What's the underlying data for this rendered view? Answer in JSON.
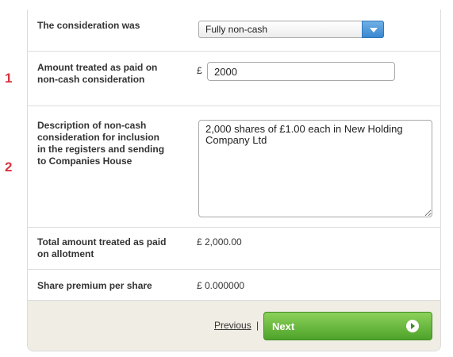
{
  "markers": [
    "1",
    "2"
  ],
  "rows": {
    "consideration": {
      "label": "The consideration was",
      "selected": "Fully non-cash"
    },
    "amount_paid": {
      "label": "Amount treated as paid on non-cash consideration",
      "currency": "£",
      "value": "2000"
    },
    "description": {
      "label": "Description of non-cash consideration for inclusion in the registers and sending to Companies House",
      "value": "2,000 shares of £1.00 each in New Holding Company Ltd"
    },
    "total": {
      "label": "Total amount treated as paid on allotment",
      "value": "£ 2,000.00"
    },
    "premium": {
      "label": "Share premium per share",
      "value": "£ 0.000000"
    }
  },
  "footer": {
    "previous": "Previous",
    "separator": "|",
    "next": "Next"
  },
  "icons": {
    "select_arrow": "chevron-down-icon",
    "next_arrow": "play-circle-icon"
  },
  "colors": {
    "marker": "#d9333f",
    "next_button": "#5cb230",
    "dropdown_button": "#3b87cf"
  }
}
